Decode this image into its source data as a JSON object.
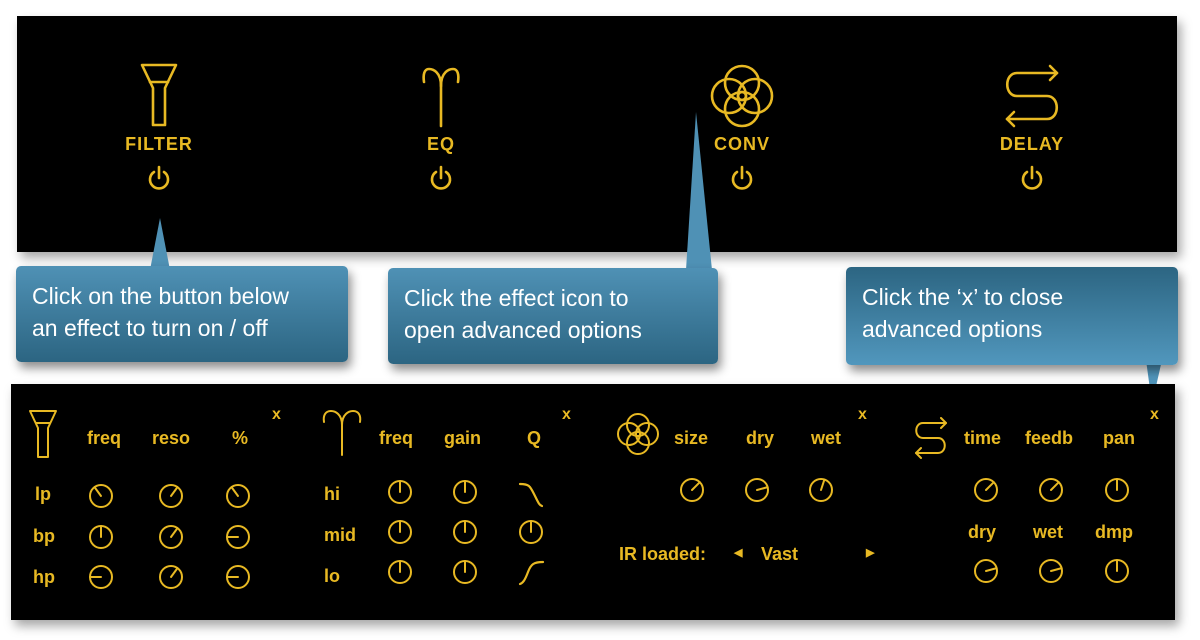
{
  "effects": [
    {
      "id": "filter",
      "label": "FILTER",
      "icon": "funnel-icon",
      "power_icon": "power-icon"
    },
    {
      "id": "eq",
      "label": "EQ",
      "icon": "aries-horns-icon",
      "power_icon": "power-icon"
    },
    {
      "id": "conv",
      "label": "CONV",
      "icon": "overlapping-circles-icon",
      "power_icon": "power-icon"
    },
    {
      "id": "delay",
      "label": "DELAY",
      "icon": "s-arrows-icon",
      "power_icon": "power-icon"
    }
  ],
  "callouts": [
    {
      "text_line1": "Click on the button below",
      "text_line2": "an effect to turn on / off"
    },
    {
      "text_line1": "Click the effect icon to",
      "text_line2": "open advanced options"
    },
    {
      "text_line1": "Click the ‘x’ to close",
      "text_line2": "advanced options"
    }
  ],
  "advanced": {
    "close_label": "x",
    "filter": {
      "columns": [
        "freq",
        "reso",
        "%"
      ],
      "rows": [
        {
          "label": "lp",
          "knobs": [
            0.38,
            0.62,
            0.38
          ]
        },
        {
          "label": "bp",
          "knobs": [
            0.5,
            0.62,
            0.2
          ]
        },
        {
          "label": "hp",
          "knobs": [
            0.2,
            0.62,
            0.2
          ]
        }
      ]
    },
    "eq": {
      "columns": [
        "freq",
        "gain",
        "Q"
      ],
      "rows": [
        {
          "label": "hi",
          "knobs": [
            0.5,
            0.5
          ],
          "q": "high-shelf-curve"
        },
        {
          "label": "mid",
          "knobs": [
            0.5,
            0.5,
            0.5
          ],
          "q": "knob"
        },
        {
          "label": "lo",
          "knobs": [
            0.5,
            0.5
          ],
          "q": "low-shelf-curve"
        }
      ]
    },
    "conv": {
      "columns": [
        "size",
        "dry",
        "wet"
      ],
      "knobs": [
        0.65,
        0.75,
        0.56
      ],
      "ir_label": "IR loaded:",
      "ir_value": "Vast",
      "prev_icon": "triangle-left-icon",
      "next_icon": "triangle-right-icon"
    },
    "delay": {
      "columns_top": [
        "time",
        "feedb",
        "pan"
      ],
      "knobs_top": [
        0.65,
        0.65,
        0.5
      ],
      "columns_bottom": [
        "dry",
        "wet",
        "dmp"
      ],
      "knobs_bottom": [
        0.75,
        0.75,
        0.5
      ]
    }
  }
}
